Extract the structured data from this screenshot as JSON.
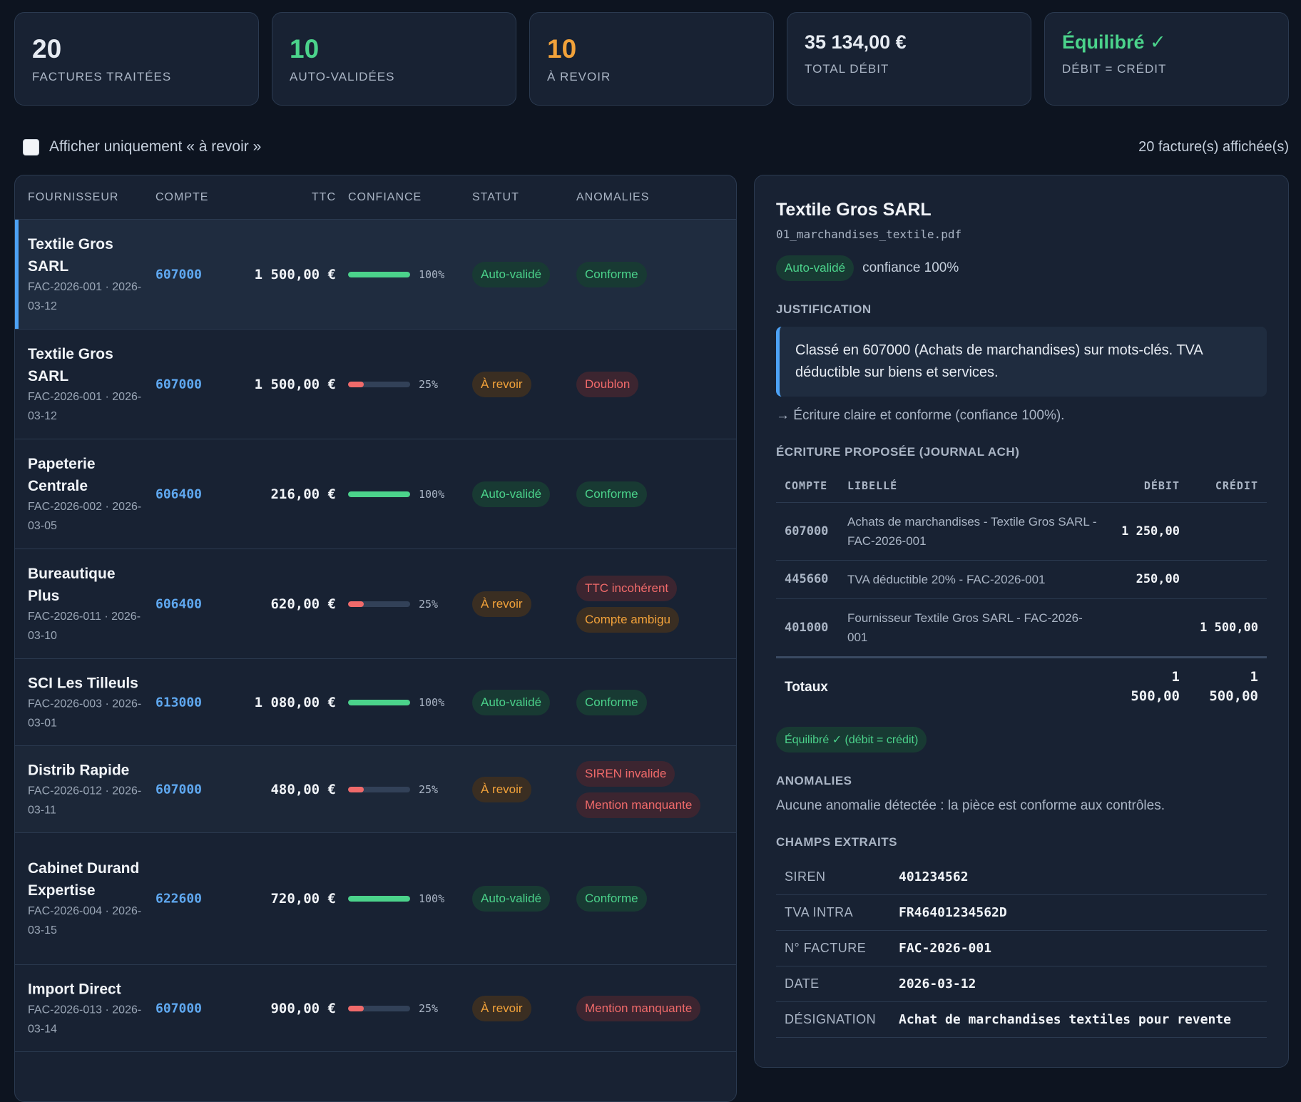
{
  "stats": [
    {
      "value": "20",
      "label": "Factures traitées",
      "color": "#f1f4f8"
    },
    {
      "value": "10",
      "label": "Auto-validées",
      "color": "#4bd38b"
    },
    {
      "value": "10",
      "label": "À revoir",
      "color": "#f2a23a"
    },
    {
      "value": "35 134,00 €",
      "label": "Total débit",
      "color": "#f1f4f8"
    },
    {
      "value": "Équilibré ✓",
      "label": "Débit = Crédit",
      "color": "#4bd38b"
    }
  ],
  "filter": {
    "label": "Afficher uniquement « à revoir »",
    "checked": false
  },
  "count_label": "20 facture(s) affichée(s)",
  "table": {
    "headers": [
      "Fournisseur",
      "Compte",
      "TTC",
      "Confiance",
      "Statut",
      "Anomalies"
    ],
    "rows": [
      {
        "name": "Textile Gros SARL",
        "ref": "FAC-2026-001 · 2026-03-12",
        "account": "607000",
        "ttc": "1 500,00 €",
        "confidence": 100,
        "confidence_label": "100%",
        "status": "Auto-validé",
        "anomalies": [
          "Conforme"
        ]
      },
      {
        "name": "Textile Gros SARL",
        "ref": "FAC-2026-001 · 2026-03-12",
        "account": "607000",
        "ttc": "1 500,00 €",
        "confidence": 25,
        "confidence_label": "25%",
        "status": "À revoir",
        "anomalies": [
          "Doublon"
        ]
      },
      {
        "name": "Papeterie Centrale",
        "ref": "FAC-2026-002 · 2026-03-05",
        "account": "606400",
        "ttc": "216,00 €",
        "confidence": 100,
        "confidence_label": "100%",
        "status": "Auto-validé",
        "anomalies": [
          "Conforme"
        ]
      },
      {
        "name": "Bureautique Plus",
        "ref": "FAC-2026-011 · 2026-03-10",
        "account": "606400",
        "ttc": "620,00 €",
        "confidence": 25,
        "confidence_label": "25%",
        "status": "À revoir",
        "anomalies": [
          "TTC incohérent",
          "Compte ambigu"
        ]
      },
      {
        "name": "SCI Les Tilleuls",
        "ref": "FAC-2026-003 · 2026-03-01",
        "account": "613000",
        "ttc": "1 080,00 €",
        "confidence": 100,
        "confidence_label": "100%",
        "status": "Auto-validé",
        "anomalies": [
          "Conforme"
        ]
      },
      {
        "name": "Distrib Rapide",
        "ref": "FAC-2026-012 · 2026-03-11",
        "account": "607000",
        "ttc": "480,00 €",
        "confidence": 25,
        "confidence_label": "25%",
        "status": "À revoir",
        "anomalies": [
          "SIREN invalide",
          "Mention manquante"
        ]
      },
      {
        "name": "Cabinet Durand Expertise",
        "ref": "FAC-2026-004 · 2026-03-15",
        "account": "622600",
        "ttc": "720,00 €",
        "confidence": 100,
        "confidence_label": "100%",
        "status": "Auto-validé",
        "anomalies": [
          "Conforme"
        ]
      },
      {
        "name": "Import Direct",
        "ref": "FAC-2026-013 · 2026-03-14",
        "account": "607000",
        "ttc": "900,00 €",
        "confidence": 25,
        "confidence_label": "25%",
        "status": "À revoir",
        "anomalies": [
          "Mention manquante"
        ]
      }
    ]
  },
  "detail": {
    "title": "Textile Gros SARL",
    "file": "01_marchandises_textile.pdf",
    "status": "Auto-validé",
    "confidence_text": "confiance 100%",
    "justification_title": "Justification",
    "justification": "Classé en 607000 (Achats de marchandises) sur mots-clés. TVA déductible sur biens et services.",
    "note": "→ Écriture claire et conforme (confiance 100%).",
    "entry_title": "Écriture proposée (journal ACH)",
    "entry_headers": [
      "COMPTE",
      "LIBELLÉ",
      "DÉBIT",
      "CRÉDIT"
    ],
    "entry_rows": [
      {
        "account": "607000",
        "label": "Achats de marchandises - Textile Gros SARL - FAC-2026-001",
        "debit": "1 250,00",
        "credit": ""
      },
      {
        "account": "445660",
        "label": "TVA déductible 20% - FAC-2026-001",
        "debit": "250,00",
        "credit": ""
      },
      {
        "account": "401000",
        "label": "Fournisseur Textile Gros SARL - FAC-2026-001",
        "debit": "",
        "credit": "1 500,00"
      }
    ],
    "totals_label": "Totaux",
    "totals_debit": "1 500,00",
    "totals_credit": "1 500,00",
    "balance_badge": "Équilibré ✓ (débit = crédit)",
    "anomalies_title": "Anomalies",
    "anomalies_text": "Aucune anomalie détectée : la pièce est conforme aux contrôles.",
    "fields_title": "Champs extraits",
    "fields": [
      {
        "key": "SIREN",
        "value": "401234562"
      },
      {
        "key": "TVA intra",
        "value": "FR46401234562D"
      },
      {
        "key": "N° facture",
        "value": "FAC-2026-001"
      },
      {
        "key": "Date",
        "value": "2026-03-12"
      },
      {
        "key": "Désignation",
        "value": "Achat de marchandises textiles pour revente"
      }
    ]
  },
  "colors": {
    "accent": "#4da2f5",
    "green": "#4bd38b",
    "orange": "#f2a23a",
    "red": "#f06a6a"
  }
}
